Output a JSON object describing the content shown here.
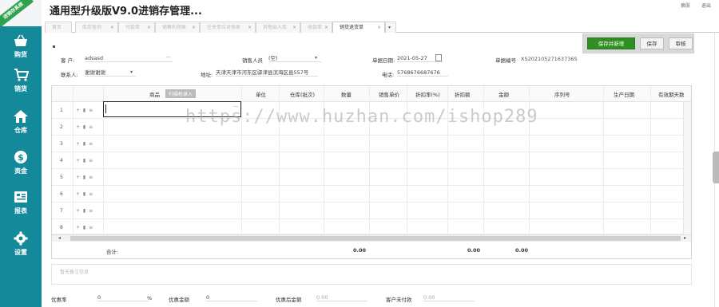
{
  "app": {
    "title": "通用型升级版V9.0进销存管理...",
    "top_links": [
      "换肤",
      "退出"
    ]
  },
  "sidebar": {
    "brand_ribbon": "进销存系统",
    "items": [
      {
        "label": "购货",
        "icon": "basket-icon"
      },
      {
        "label": "销货",
        "icon": "cart-icon"
      },
      {
        "label": "仓库",
        "icon": "home-icon"
      },
      {
        "label": "资金",
        "icon": "dollar-icon"
      },
      {
        "label": "报表",
        "icon": "report-icon"
      },
      {
        "label": "设置",
        "icon": "gear-icon"
      }
    ],
    "colors": {
      "bg": "#13899a",
      "ribbon": "#31a24c"
    }
  },
  "tabs": [
    {
      "label": "首页"
    },
    {
      "label": "库存查询"
    },
    {
      "label": "付款单"
    },
    {
      "label": "销售利润表"
    },
    {
      "label": "往来单位对账表"
    },
    {
      "label": "其他出入库"
    },
    {
      "label": "收款单"
    },
    {
      "label": "销货退货单",
      "active": true
    }
  ],
  "actions": {
    "save_new": "保存并新增",
    "save": "保存",
    "audit": "审核"
  },
  "form": {
    "customer_label": "客  户:",
    "customer_value": "adsasd",
    "salesperson_label": "销售人员",
    "salesperson_value": "(空)",
    "date_label": "单据日期:",
    "date_value": "2021-05-27",
    "docno_label": "单据编号",
    "docno_value": "XS20210527163736S",
    "contact_label": "联系人:",
    "contact_value": "谢谢谢谢",
    "address_label": "地址:",
    "address_value": "天津天津市河东区驿津县滨海区县557号",
    "phone_label": "电话:",
    "phone_value": "5768676687676"
  },
  "grid": {
    "columns": [
      "商品",
      "单位",
      "仓库(批次)",
      "数量",
      "销售单价",
      "折扣率(%)",
      "折扣额",
      "金额",
      "序列号",
      "生产日期",
      "有效期天数"
    ],
    "scan_button": "扫描枪录入",
    "rows": [
      "1",
      "2",
      "3",
      "4",
      "5",
      "6",
      "7",
      "8"
    ],
    "totals_label": "合计:",
    "totals": [
      "0.00",
      "0.00",
      "0.00"
    ]
  },
  "remark_placeholder": "暂无备注信息",
  "footer": {
    "discount_rate_label": "优惠率",
    "discount_rate_value": "0",
    "discount_rate_unit": "%",
    "discount_amount_label": "优惠金额",
    "discount_amount_value": "0",
    "after_discount_label": "优惠后金额",
    "after_discount_value": "0.00",
    "receivable_label": "客户未付款",
    "receivable_value": "0.00"
  },
  "watermark": "https://www.huzhan.com/ishop289"
}
